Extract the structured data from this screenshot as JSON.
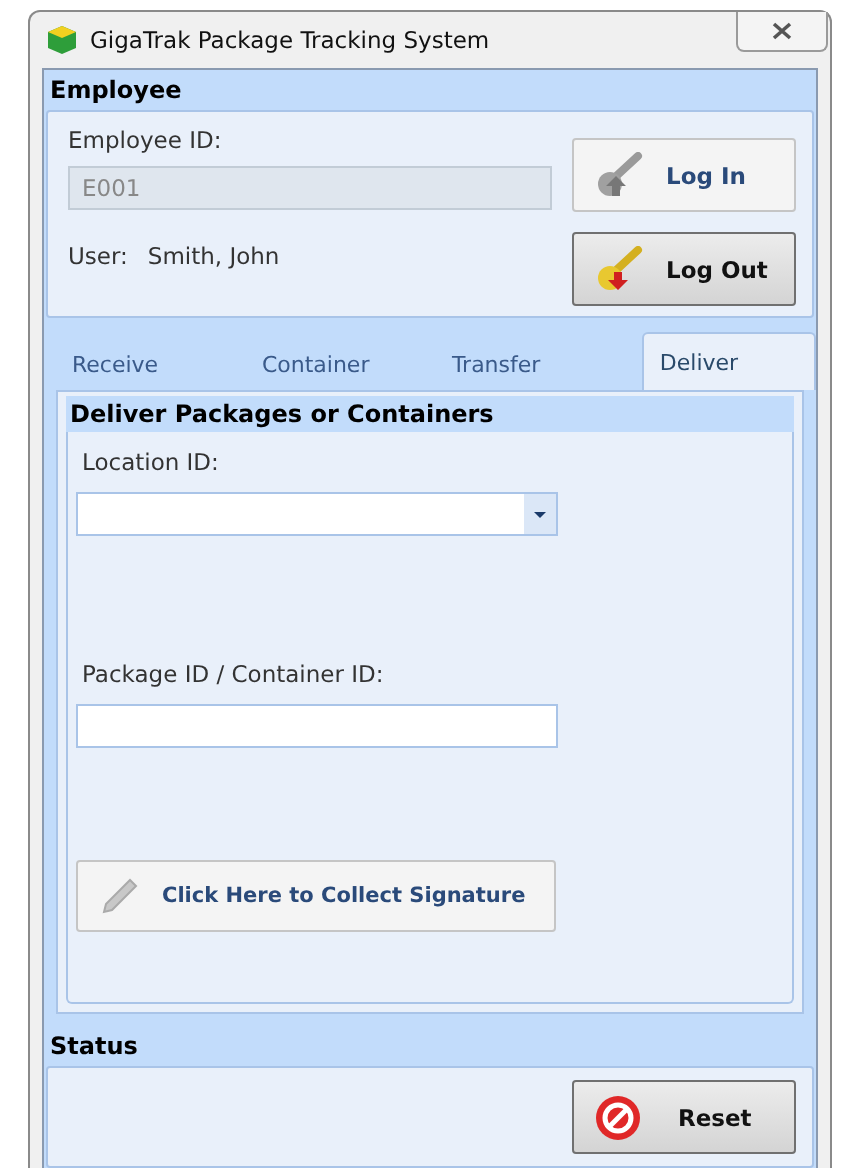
{
  "window": {
    "title": "GigaTrak Package Tracking System"
  },
  "employee": {
    "title": "Employee",
    "id_label": "Employee ID:",
    "id_field": {
      "value": "E001",
      "disabled": true
    },
    "user_label": "User:",
    "user_name": "Smith, John",
    "buttons": [
      {
        "kind": "login",
        "label": "Log In",
        "pressed": false
      },
      {
        "kind": "logout",
        "label": "Log Out",
        "pressed": true
      }
    ]
  },
  "tabs": [
    {
      "label": "Receive",
      "selected": false
    },
    {
      "label": "Container",
      "selected": false
    },
    {
      "label": "Transfer",
      "selected": false
    },
    {
      "label": "Deliver",
      "selected": true
    }
  ],
  "deliver": {
    "title": "Deliver Packages or Containers",
    "location_label": "Location ID:",
    "package_label": "Package ID / Container ID:",
    "signature_button": "Click Here to Collect Signature"
  },
  "status": {
    "title": "Status",
    "reset_button": "Reset"
  }
}
